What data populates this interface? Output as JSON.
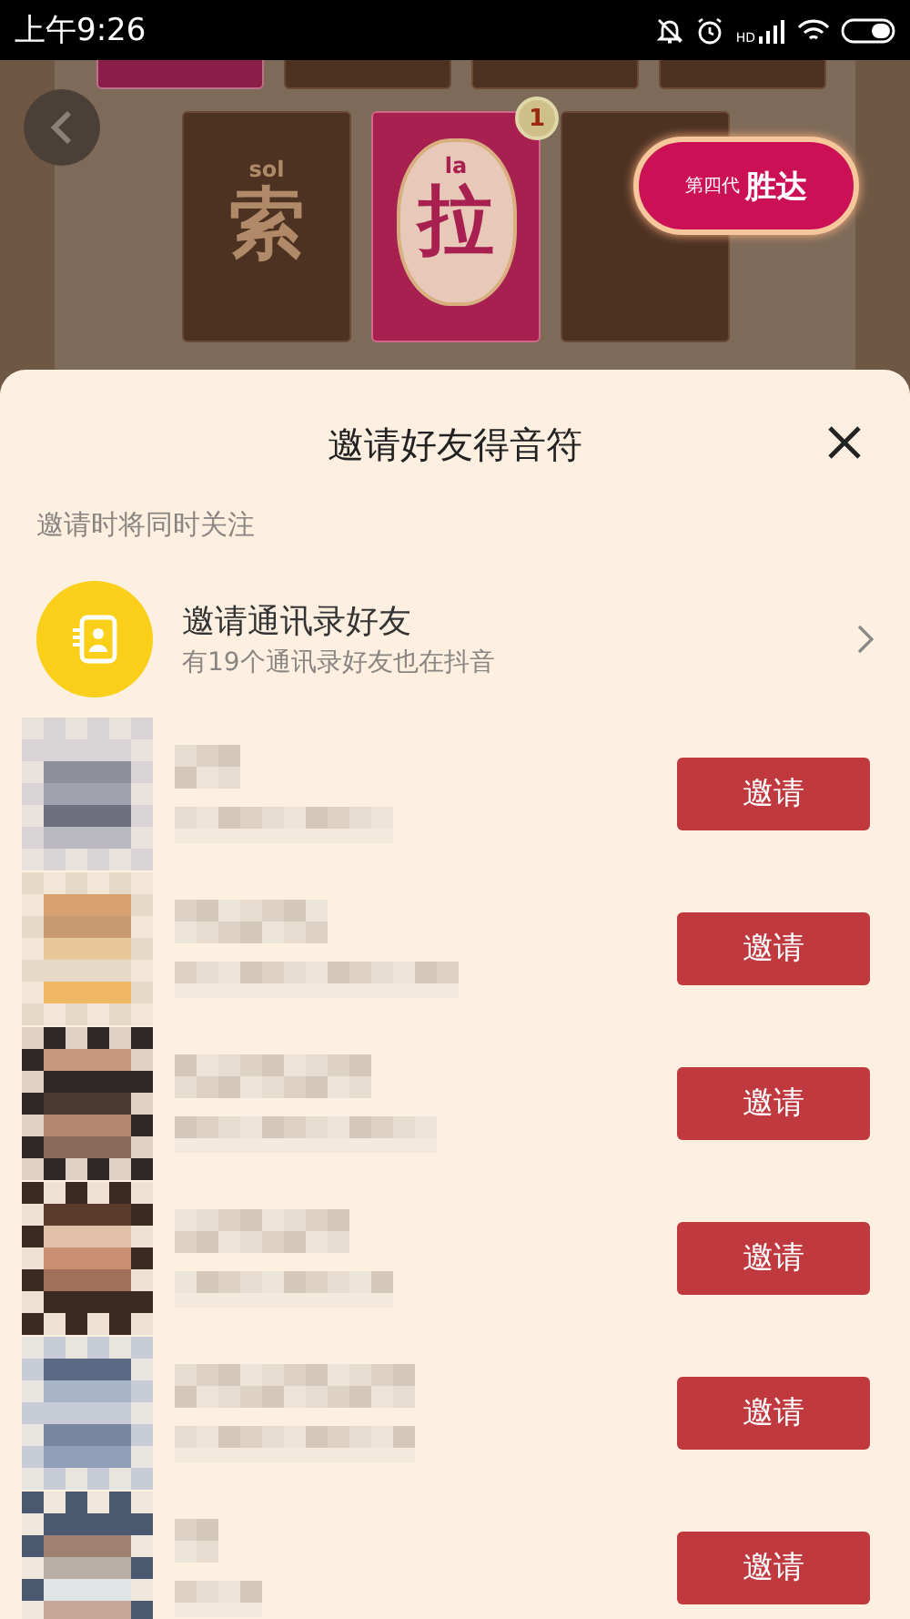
{
  "status_bar": {
    "time": "上午9:26",
    "signal_label": "HD"
  },
  "game": {
    "top_cards": [
      {
        "kind": "pink"
      },
      {
        "kind": "brown"
      },
      {
        "kind": "brown"
      },
      {
        "kind": "brown"
      }
    ],
    "cards": [
      {
        "kind": "brown",
        "note": "sol",
        "character": "索"
      },
      {
        "kind": "pink",
        "note": "la",
        "character": "拉",
        "count": "1"
      },
      {
        "kind": "brown"
      }
    ],
    "badge": {
      "prefix": "第四代",
      "name": "胜达"
    }
  },
  "sheet": {
    "title": "邀请好友得音符",
    "subtitle": "邀请时将同时关注",
    "contacts": {
      "title": "邀请通讯录好友",
      "subtitle": "有19个通讯录好友也在抖音"
    },
    "friends": [
      {
        "button": "邀请"
      },
      {
        "button": "邀请"
      },
      {
        "button": "邀请"
      },
      {
        "button": "邀请"
      },
      {
        "button": "邀请"
      },
      {
        "button": "邀请"
      }
    ]
  }
}
